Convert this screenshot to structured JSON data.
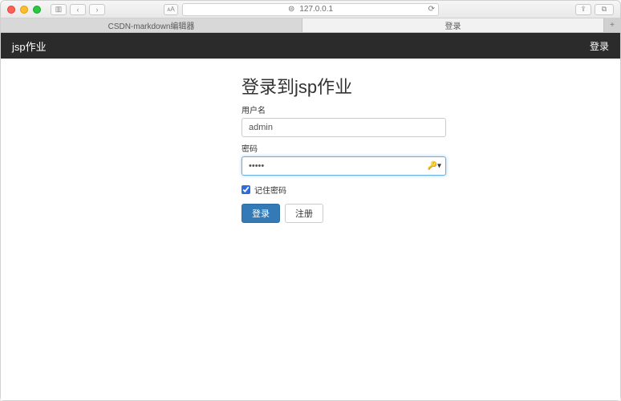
{
  "browser": {
    "address": "127.0.0.1",
    "tabs": [
      {
        "label": "CSDN-markdown编辑器",
        "active": false
      },
      {
        "label": "登录",
        "active": true
      }
    ]
  },
  "navbar": {
    "brand": "jsp作业",
    "right_link": "登录"
  },
  "login": {
    "title": "登录到jsp作业",
    "username_label": "用户名",
    "username_value": "admin",
    "password_label": "密码",
    "password_value": "•••••",
    "remember_label": "记住密码",
    "remember_checked": true,
    "submit_label": "登录",
    "register_label": "注册"
  }
}
